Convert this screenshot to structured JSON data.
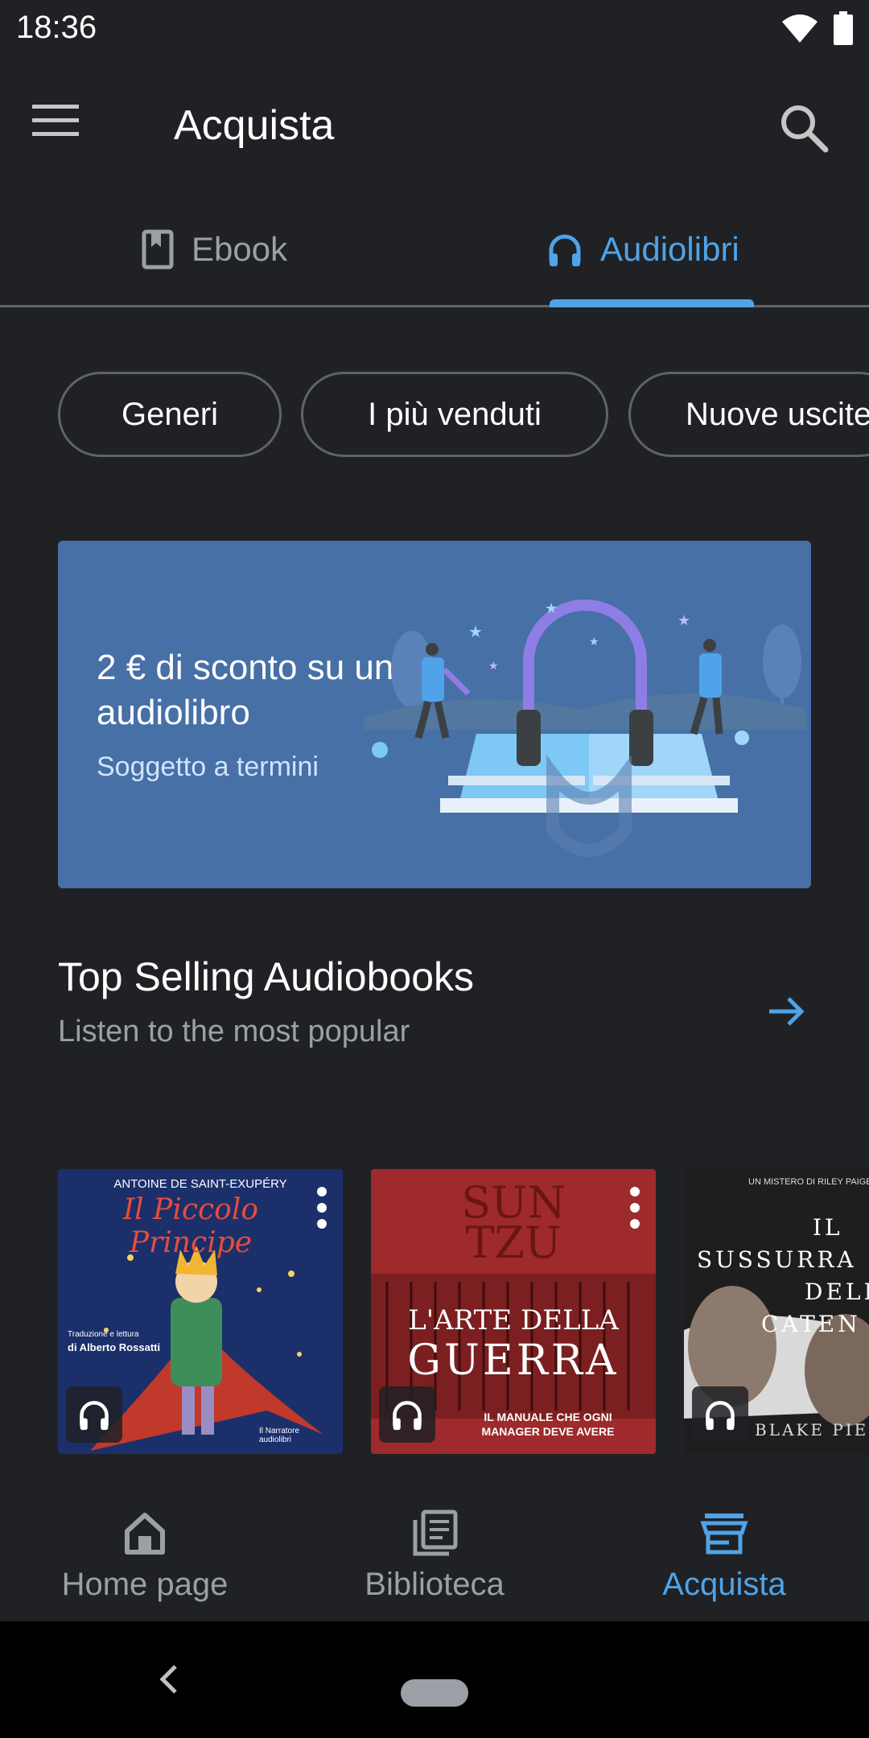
{
  "status_bar": {
    "time": "18:36"
  },
  "app_bar": {
    "title": "Acquista"
  },
  "tabs": [
    {
      "label": "Ebook",
      "icon": "book-icon",
      "selected": false
    },
    {
      "label": "Audiolibri",
      "icon": "headphones-icon",
      "selected": true
    }
  ],
  "chips": [
    "Generi",
    "I più venduti",
    "Nuove uscite"
  ],
  "promo": {
    "title": "2 € di sconto su un audiolibro",
    "subtitle": "Soggetto a termini",
    "background_color": "#4670a6"
  },
  "section": {
    "title": "Top Selling Audiobooks",
    "subtitle": "Listen to the most popular"
  },
  "books": [
    {
      "author": "ANTOINE DE SAINT-EXUPÉRY",
      "title": "Il Piccolo Principe",
      "credit_line1": "Traduzione e lettura",
      "credit_line2": "di Alberto Rossatti",
      "publisher": "Il Narratore audiolibri",
      "cover_color": "#1b2f6b"
    },
    {
      "author_line1": "SUN",
      "author_line2": "TZU",
      "title_line1": "L'ARTE DELLA",
      "title_line2": "GUERRA",
      "tagline_line1": "IL MANUALE CHE OGNI",
      "tagline_line2": "MANAGER DEVE AVERE",
      "cover_color": "#9e2a2b"
    },
    {
      "series": "UN MISTERO DI RILEY PAIGE—",
      "title_line1": "IL",
      "title_line2": "SUSSURRA",
      "title_line3": "DELLE",
      "title_line4": "CATEN",
      "author": "BLAKE PIER",
      "cover_color": "#2a2a2a"
    }
  ],
  "bottom_nav": [
    {
      "label": "Home page",
      "icon": "home-icon",
      "active": false
    },
    {
      "label": "Biblioteca",
      "icon": "library-icon",
      "active": false
    },
    {
      "label": "Acquista",
      "icon": "store-icon",
      "active": true
    }
  ],
  "accent_color": "#4fa3e8"
}
